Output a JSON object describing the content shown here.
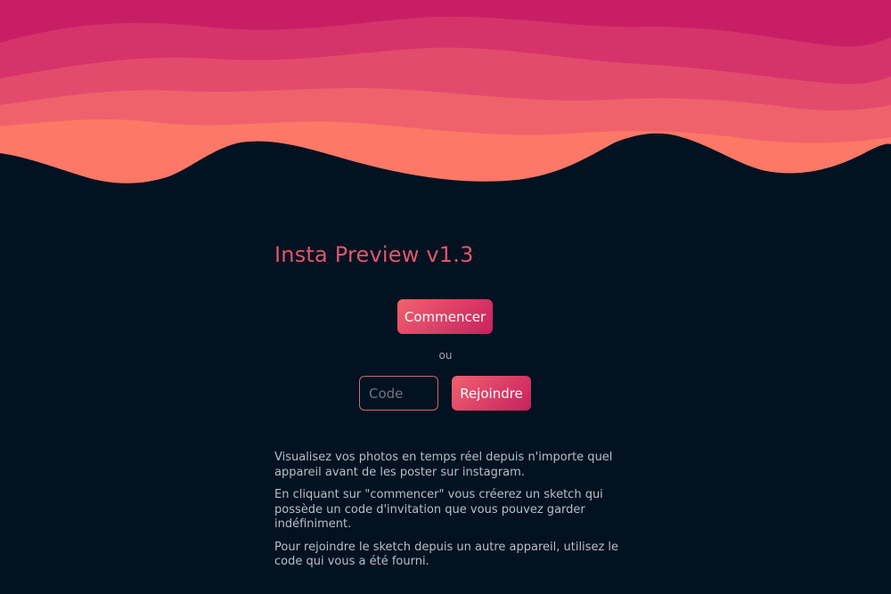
{
  "app": {
    "title": "Insta Preview v1.3"
  },
  "actions": {
    "start_label": "Commencer",
    "or_label": "ou",
    "code_placeholder": "Code",
    "join_label": "Rejoindre"
  },
  "description": {
    "paragraphs": [
      "Visualisez vos photos en temps réel depuis n'importe quel appareil avant de les poster sur instagram.",
      "En cliquant sur \"commencer\" vous créerez un sketch qui possède un code d'invitation que vous pouvez garder indéfiniment.",
      "Pour rejoindre le sketch depuis un autre appareil, utilisez le code qui vous a été fourni."
    ]
  },
  "colors": {
    "background": "#021220",
    "accent": "#e0566b",
    "wave_top": "#c81f64",
    "wave_bottom": "#fd7866",
    "button_gradient_start": "#f0616e",
    "button_gradient_end": "#c8215f"
  }
}
